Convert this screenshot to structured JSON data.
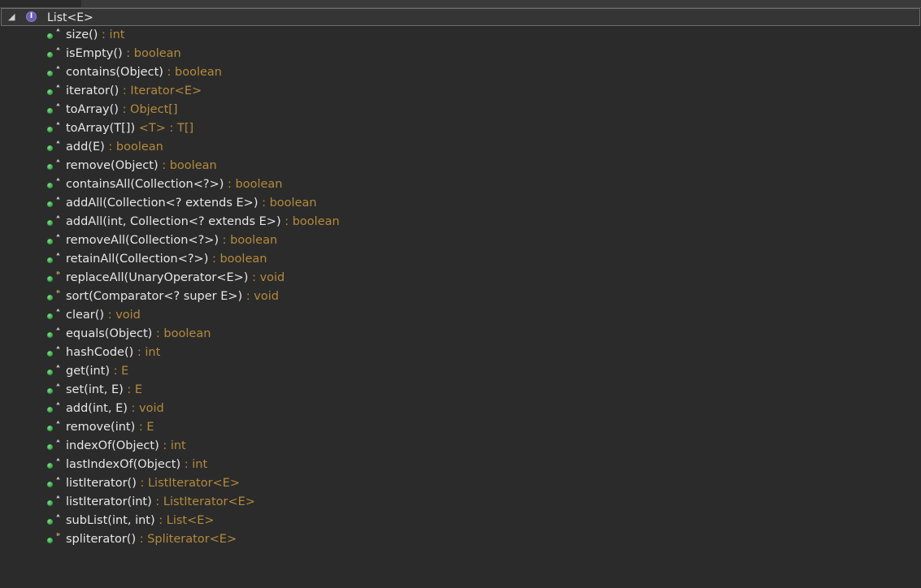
{
  "root": {
    "label": "List<E>",
    "twisty": "◢",
    "icon": "interface-icon",
    "icon_glyph": "I"
  },
  "colors": {
    "background": "#2b2b2b",
    "text": "#e6e6e6",
    "return_type": "#b48a3c",
    "public_dot": "#2f9a3e"
  },
  "methods": [
    {
      "name": "size()",
      "ret": " : int",
      "kind": "abstract"
    },
    {
      "name": "isEmpty()",
      "ret": " : boolean",
      "kind": "abstract"
    },
    {
      "name": "contains(Object)",
      "ret": " : boolean",
      "kind": "abstract"
    },
    {
      "name": "iterator()",
      "ret": " : Iterator<E>",
      "kind": "abstract"
    },
    {
      "name": "toArray()",
      "ret": " : Object[]",
      "kind": "abstract"
    },
    {
      "name": "toArray(T[])",
      "ret": " <T> : T[]",
      "kind": "abstract"
    },
    {
      "name": "add(E)",
      "ret": " : boolean",
      "kind": "abstract"
    },
    {
      "name": "remove(Object)",
      "ret": " : boolean",
      "kind": "abstract"
    },
    {
      "name": "containsAll(Collection<?>)",
      "ret": " : boolean",
      "kind": "abstract"
    },
    {
      "name": "addAll(Collection<? extends E>)",
      "ret": " : boolean",
      "kind": "abstract"
    },
    {
      "name": "addAll(int, Collection<? extends E>)",
      "ret": " : boolean",
      "kind": "abstract"
    },
    {
      "name": "removeAll(Collection<?>)",
      "ret": " : boolean",
      "kind": "abstract"
    },
    {
      "name": "retainAll(Collection<?>)",
      "ret": " : boolean",
      "kind": "abstract"
    },
    {
      "name": "replaceAll(UnaryOperator<E>)",
      "ret": " : void",
      "kind": "default"
    },
    {
      "name": "sort(Comparator<? super E>)",
      "ret": " : void",
      "kind": "default"
    },
    {
      "name": "clear()",
      "ret": " : void",
      "kind": "abstract"
    },
    {
      "name": "equals(Object)",
      "ret": " : boolean",
      "kind": "abstract"
    },
    {
      "name": "hashCode()",
      "ret": " : int",
      "kind": "abstract"
    },
    {
      "name": "get(int)",
      "ret": " : E",
      "kind": "abstract"
    },
    {
      "name": "set(int, E)",
      "ret": " : E",
      "kind": "abstract"
    },
    {
      "name": "add(int, E)",
      "ret": " : void",
      "kind": "abstract"
    },
    {
      "name": "remove(int)",
      "ret": " : E",
      "kind": "abstract"
    },
    {
      "name": "indexOf(Object)",
      "ret": " : int",
      "kind": "abstract"
    },
    {
      "name": "lastIndexOf(Object)",
      "ret": " : int",
      "kind": "abstract"
    },
    {
      "name": "listIterator()",
      "ret": " : ListIterator<E>",
      "kind": "abstract"
    },
    {
      "name": "listIterator(int)",
      "ret": " : ListIterator<E>",
      "kind": "abstract"
    },
    {
      "name": "subList(int, int)",
      "ret": " : List<E>",
      "kind": "abstract"
    },
    {
      "name": "spliterator()",
      "ret": " : Spliterator<E>",
      "kind": "default"
    }
  ]
}
